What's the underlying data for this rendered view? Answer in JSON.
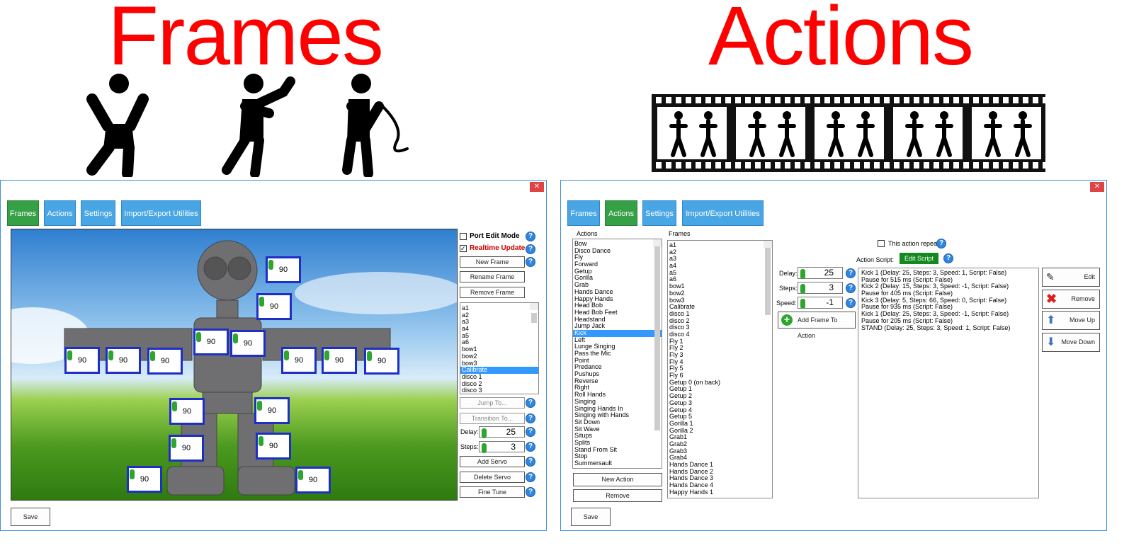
{
  "headers": {
    "frames": "Frames",
    "actions": "Actions"
  },
  "colors": {
    "title": "#ff0000",
    "tab_active": "#35a046",
    "tab": "#49a6e4",
    "selection": "#3399ff",
    "servo_border": "#1d2fc4"
  },
  "frames_window": {
    "close": "✕",
    "tabs": [
      "Frames",
      "Actions",
      "Settings",
      "Import/Export Utilities"
    ],
    "active_tab": "Frames",
    "port_edit_mode": {
      "label": "Port Edit Mode",
      "checked": false
    },
    "realtime_update": {
      "label": "Realtime Update",
      "checked": true
    },
    "buttons": {
      "new_frame": "New Frame",
      "rename_frame": "Rename Frame",
      "remove_frame": "Remove Frame",
      "jump_to": "Jump To...",
      "transition_to": "Transition To...",
      "add_servo": "Add Servo",
      "delete_servo": "Delete Servo",
      "fine_tune": "Fine Tune",
      "save": "Save"
    },
    "frame_list": [
      "a1",
      "a2",
      "a3",
      "a4",
      "a5",
      "a6",
      "bow1",
      "bow2",
      "bow3",
      "Calibrate",
      "disco 1",
      "disco 2",
      "disco 3"
    ],
    "selected_frame": "Calibrate",
    "delay": {
      "label": "Delay:",
      "value": "25"
    },
    "steps": {
      "label": "Steps:",
      "value": "3"
    },
    "servo_values": [
      "90",
      "90",
      "90",
      "90",
      "90",
      "90",
      "90",
      "90",
      "90",
      "90",
      "90",
      "90",
      "90",
      "90",
      "90",
      "90"
    ]
  },
  "actions_window": {
    "close": "✕",
    "tabs": [
      "Frames",
      "Actions",
      "Settings",
      "Import/Export Utilities"
    ],
    "active_tab": "Actions",
    "actions_label": "Actions",
    "frames_label": "Frames",
    "actions_list": [
      "Bow",
      "Disco Dance",
      "Fly",
      "Forward",
      "Getup",
      "Gorilla",
      "Grab",
      "Hands Dance",
      "Happy Hands",
      "Head Bob",
      "Head Bob Feet",
      "Headstand",
      "Jump Jack",
      "Kick",
      "Left",
      "Lunge Singing",
      "Pass the Mic",
      "Point",
      "Predance",
      "Pushups",
      "Reverse",
      "Right",
      "Roll Hands",
      "Singing",
      "Singing Hands In",
      "Singing with Hands",
      "Sit Down",
      "Sit Wave",
      "Situps",
      "Splits",
      "Stand From Sit",
      "Stop",
      "Summersault"
    ],
    "selected_action": "Kick",
    "frames_list": [
      "a1",
      "a2",
      "a3",
      "a4",
      "a5",
      "a6",
      "bow1",
      "bow2",
      "bow3",
      "Calibrate",
      "disco 1",
      "disco 2",
      "disco 3",
      "disco 4",
      "Fly 1",
      "Fly 2",
      "Fly 3",
      "Fly 4",
      "Fly 5",
      "Fly 6",
      "Getup 0 (on back)",
      "Getup 1",
      "Getup 2",
      "Getup 3",
      "Getup 4",
      "Getup 5",
      "Gorilla 1",
      "Gorilla 2",
      "Grab1",
      "Grab2",
      "Grab3",
      "Grab4",
      "Hands Dance 1",
      "Hands Dance 2",
      "Hands Dance 3",
      "Hands Dance 4",
      "Happy Hands 1"
    ],
    "repeats": {
      "label": "This action repeats",
      "checked": false
    },
    "action_script_label": "Action Script:",
    "edit_script": "Edit Script",
    "delay": {
      "label": "Delay:",
      "value": "25"
    },
    "steps": {
      "label": "Steps:",
      "value": "3"
    },
    "speed": {
      "label": "Speed:",
      "value": "-1"
    },
    "add_frame": "Add Frame To Action",
    "script": [
      "Kick 1 (Delay: 25, Steps: 3, Speed: 1, Script: False)",
      "Pause for 515 ms (Script: False)",
      "Kick 2 (Delay: 15, Steps: 3, Speed: -1, Script: False)",
      "Pause for 405 ms (Script: False)",
      "Kick 3 (Delay: 5, Steps: 66, Speed: 0, Script: False)",
      "Pause for 935 ms (Script: False)",
      "Kick 1 (Delay: 25, Steps: 3, Speed: -1, Script: False)",
      "Pause for 205 ms (Script: False)",
      "STAND (Delay: 25, Steps: 3, Speed: 1, Script: False)"
    ],
    "buttons": {
      "edit": "Edit",
      "remove": "Remove",
      "move_up": "Move Up",
      "move_down": "Move Down",
      "new_action": "New Action",
      "remove_action": "Remove",
      "save": "Save"
    }
  }
}
